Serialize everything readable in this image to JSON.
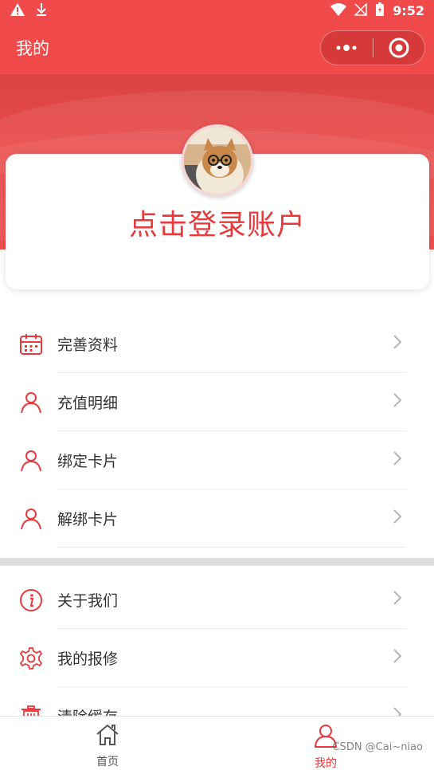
{
  "statusbar": {
    "time": "9:52"
  },
  "navbar": {
    "title": "我的"
  },
  "login": {
    "text": "点击登录账户"
  },
  "menu_group1": [
    {
      "label": "完善资料",
      "icon": "calendar-icon"
    },
    {
      "label": "充值明细",
      "icon": "person-icon"
    },
    {
      "label": "绑定卡片",
      "icon": "person-icon"
    },
    {
      "label": "解绑卡片",
      "icon": "person-icon"
    }
  ],
  "menu_group2": [
    {
      "label": "关于我们",
      "icon": "info-icon"
    },
    {
      "label": "我的报修",
      "icon": "gear-icon"
    },
    {
      "label": "清除缓存",
      "icon": "trash-icon"
    }
  ],
  "tabs": [
    {
      "label": "首页",
      "icon": "home-icon",
      "active": false
    },
    {
      "label": "我的",
      "icon": "user-icon",
      "active": true
    }
  ],
  "watermark": "CSDN @Cai~niao",
  "colors": {
    "accent": "#e8393d",
    "header": "#f04a4a"
  }
}
